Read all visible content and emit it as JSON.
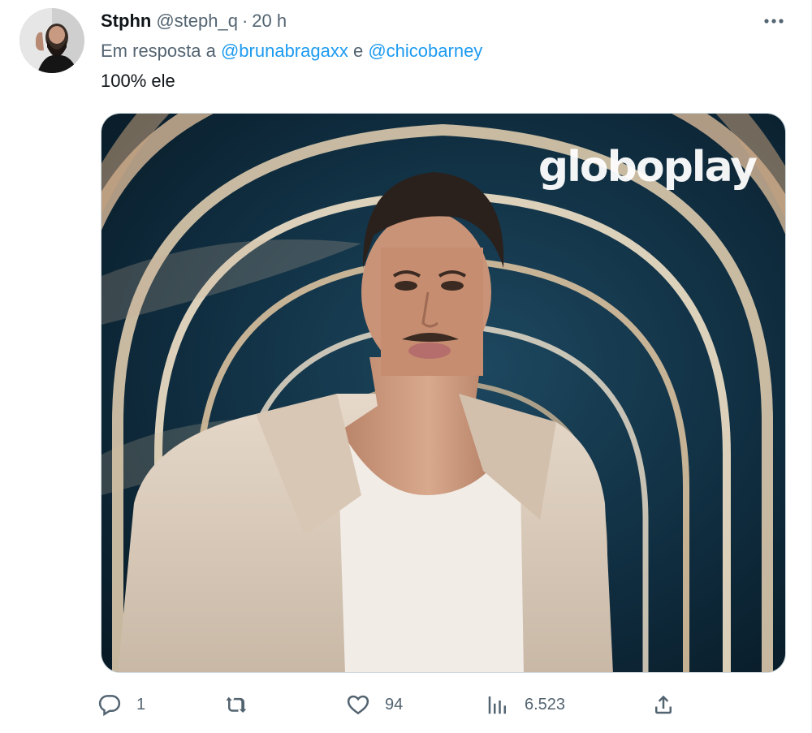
{
  "tweet": {
    "display_name": "Stphn",
    "handle": "@steph_q",
    "separator": "·",
    "time": "20 h",
    "reply_prefix": "Em resposta a",
    "reply_mention_1": "@brunabragaxx",
    "reply_conjunction": "e",
    "reply_mention_2": "@chicobarney",
    "text": "100% ele"
  },
  "media": {
    "watermark": "globoplay"
  },
  "actions": {
    "reply_count": "1",
    "retweet_count": "",
    "like_count": "94",
    "view_count": "6.523"
  },
  "icons": {
    "more": "more-icon",
    "reply": "reply-icon",
    "retweet": "retweet-icon",
    "like": "heart-icon",
    "views": "views-icon",
    "share": "share-icon"
  },
  "colors": {
    "link": "#1d9bf0",
    "secondary_text": "#536471",
    "primary_text": "#0f1419"
  }
}
